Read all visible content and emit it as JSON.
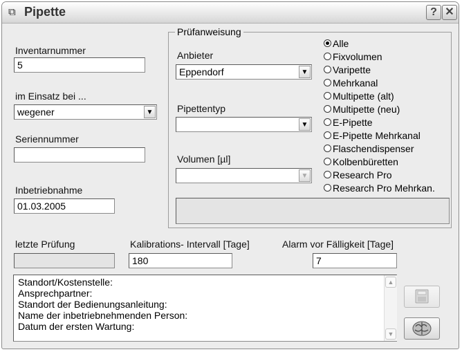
{
  "window": {
    "title": "Pipette",
    "help_label": "?",
    "close_label": "✕"
  },
  "fields": {
    "inventory": {
      "label": "Inventarnummer",
      "value": "5"
    },
    "in_use": {
      "label": "im Einsatz bei ...",
      "value": "wegener"
    },
    "serial": {
      "label": "Seriennummer",
      "value": ""
    },
    "commissioning": {
      "label": "Inbetriebnahme",
      "value": "01.03.2005"
    },
    "last_test": {
      "label": "letzte Prüfung",
      "value": ""
    },
    "calibration": {
      "label": "Kalibrations- Intervall [Tage]",
      "value": "180"
    },
    "alarm": {
      "label": "Alarm vor Fälligkeit [Tage]",
      "value": "7"
    }
  },
  "test_instruction": {
    "group_label": "Prüfanweisung",
    "supplier": {
      "label": "Anbieter",
      "value": "Eppendorf"
    },
    "pipette_type": {
      "label": "Pipettentyp",
      "value": ""
    },
    "volume": {
      "label": "Volumen [µl]",
      "value": ""
    },
    "info": ""
  },
  "radio_options": [
    {
      "label": "Alle",
      "selected": true
    },
    {
      "label": "Fixvolumen",
      "selected": false
    },
    {
      "label": "Varipette",
      "selected": false
    },
    {
      "label": "Mehrkanal",
      "selected": false
    },
    {
      "label": "Multipette (alt)",
      "selected": false
    },
    {
      "label": "Multipette (neu)",
      "selected": false
    },
    {
      "label": "E-Pipette",
      "selected": false
    },
    {
      "label": "E-Pipette Mehrkanal",
      "selected": false
    },
    {
      "label": "Flaschendispenser",
      "selected": false
    },
    {
      "label": "Kolbenbüretten",
      "selected": false
    },
    {
      "label": "Research Pro",
      "selected": false
    },
    {
      "label": "Research Pro Mehrkan.",
      "selected": false
    }
  ],
  "notes": {
    "lines": [
      "Standort/Kostenstelle:",
      "Ansprechpartner:",
      "Standort der Bedienungsanleitung:",
      "Name der inbetriebnehmenden Person:",
      "Datum der ersten Wartung:"
    ]
  },
  "icons": {
    "window": "window-icon",
    "save": "save-icon",
    "brain": "brain-icon"
  }
}
